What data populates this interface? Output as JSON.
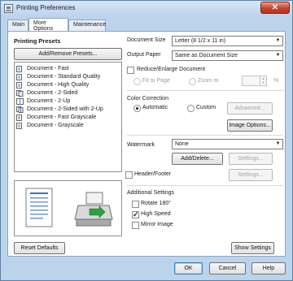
{
  "window": {
    "title": "Printing Preferences",
    "close_glyph": "✕"
  },
  "tabs": [
    {
      "label": "Main",
      "active": false
    },
    {
      "label": "More Options",
      "active": true
    },
    {
      "label": "Maintenance",
      "active": false
    }
  ],
  "presets": {
    "heading": "Printing Presets",
    "add_remove_button": "Add/Remove Presets...",
    "items": [
      "Document - Fast",
      "Document - Standard Quality",
      "Document - High Quality",
      "Document - 2-Sided",
      "Document - 2-Up",
      "Document - 2-Sided with 2-Up",
      "Document - Fast Grayscale",
      "Document - Grayscale"
    ]
  },
  "document_size": {
    "label": "Document Size",
    "value": "Letter (8 1/2 x 11 in)"
  },
  "output_paper": {
    "label": "Output Paper",
    "value": "Same as Document Size"
  },
  "reduce_enlarge": {
    "label": "Reduce/Enlarge Document",
    "checked": false,
    "fit_to_page": "Fit to Page",
    "zoom_to": "Zoom to",
    "percent": "%"
  },
  "color_correction": {
    "heading": "Color Correction",
    "automatic": "Automatic",
    "custom": "Custom",
    "advanced_button": "Advanced...",
    "image_options_button": "Image Options..."
  },
  "watermark": {
    "label": "Watermark",
    "value": "None",
    "add_delete_button": "Add/Delete...",
    "settings_button": "Settings..."
  },
  "header_footer": {
    "label": "Header/Footer",
    "checked": false,
    "settings_button": "Settings..."
  },
  "additional_settings": {
    "heading": "Additional Settings",
    "rotate": {
      "label": "Rotate 180°",
      "checked": false
    },
    "high_speed": {
      "label": "High Speed",
      "checked": true
    },
    "mirror_image": {
      "label": "Mirror Image",
      "checked": false
    }
  },
  "footer": {
    "reset_defaults": "Reset Defaults",
    "show_settings": "Show Settings",
    "ok": "OK",
    "cancel": "Cancel",
    "help": "Help"
  },
  "colors": {
    "accent": "#4b7fd1",
    "printer_green": "#2ea043"
  }
}
